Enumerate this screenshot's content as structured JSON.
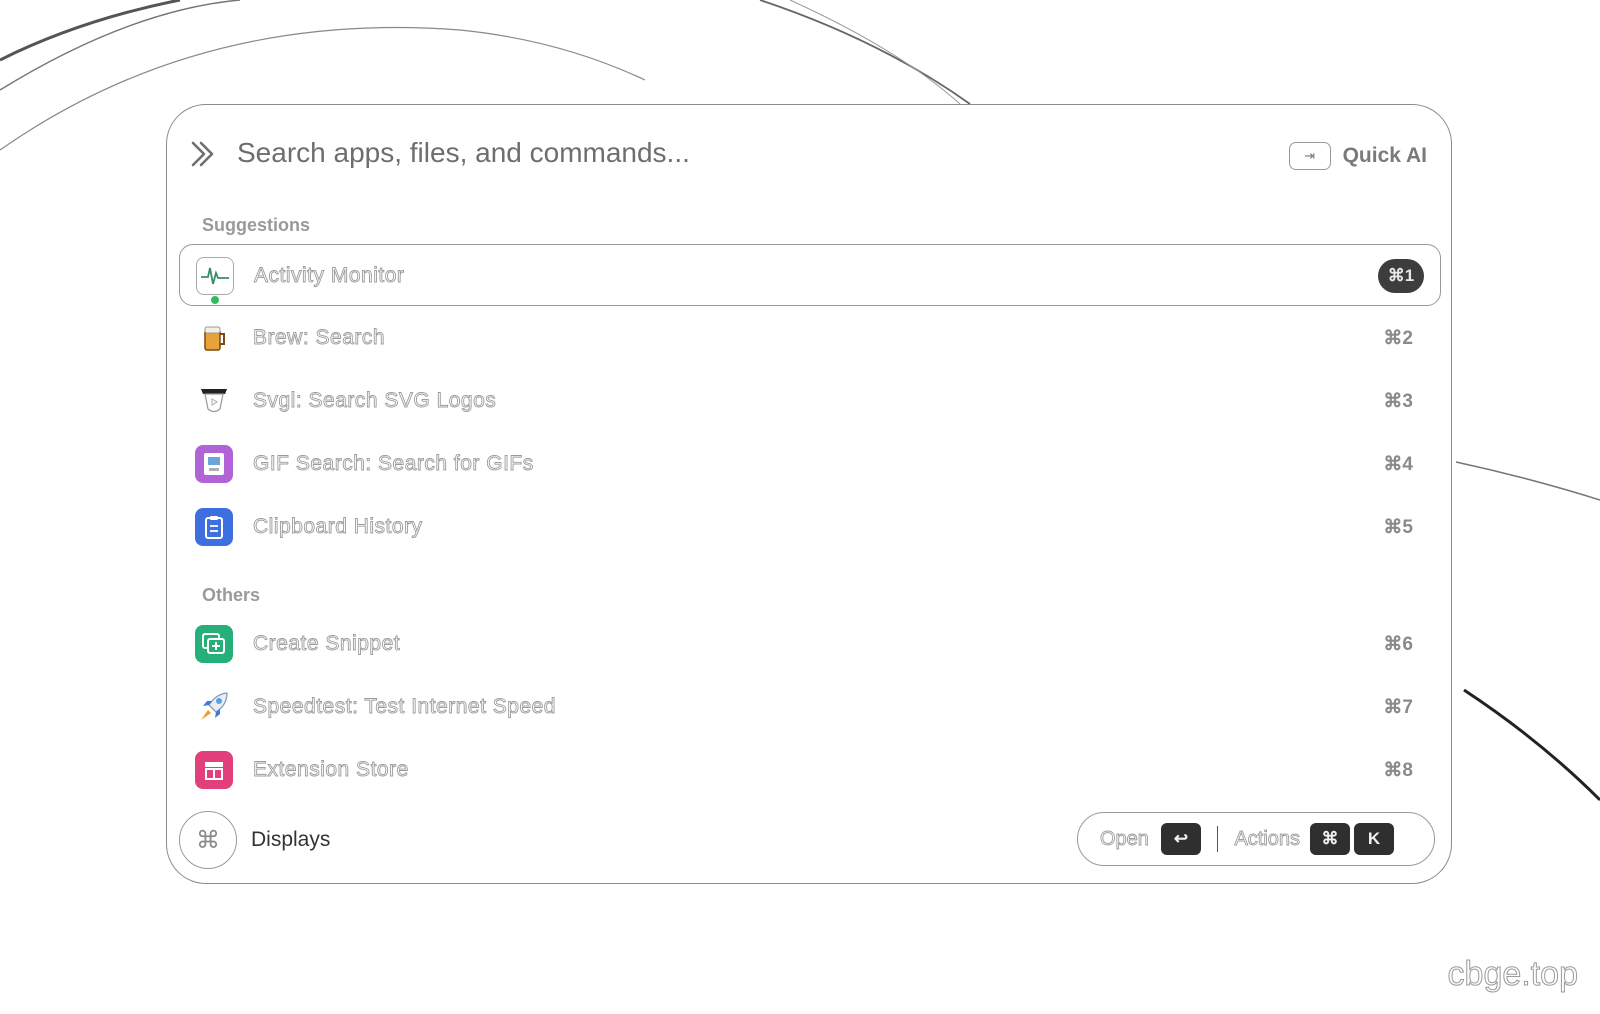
{
  "search": {
    "placeholder": "Search apps, files, and commands...",
    "quick_ai_key": "⇥",
    "quick_ai_label": "Quick AI"
  },
  "sections": {
    "suggestions": "Suggestions",
    "others": "Others"
  },
  "items": [
    {
      "title": "Activity Monitor",
      "shortcut": "⌘1",
      "icon": "activity-monitor-icon",
      "selected": true,
      "running": true
    },
    {
      "title": "Brew: Search",
      "shortcut": "⌘2",
      "icon": "beer-mug-icon"
    },
    {
      "title": "Svgl: Search SVG Logos",
      "shortcut": "⌘3",
      "icon": "svgl-logo-icon"
    },
    {
      "title": "GIF Search: Search for GIFs",
      "shortcut": "⌘4",
      "icon": "gif-search-icon",
      "color": "#b164d6"
    },
    {
      "title": "Clipboard History",
      "shortcut": "⌘5",
      "icon": "clipboard-icon",
      "color": "#3e6fe0"
    },
    {
      "title": "Create Snippet",
      "shortcut": "⌘6",
      "icon": "snippet-icon",
      "color": "#25b07a"
    },
    {
      "title": "Speedtest: Test Internet Speed",
      "shortcut": "⌘7",
      "icon": "rocket-icon"
    },
    {
      "title": "Extension Store",
      "shortcut": "⌘8",
      "icon": "store-icon",
      "color": "#e2407c"
    }
  ],
  "footer": {
    "command_symbol": "⌘",
    "context_label": "Displays",
    "open_label": "Open",
    "open_key": "↩",
    "actions_label": "Actions",
    "actions_key_1": "⌘",
    "actions_key_2": "K"
  },
  "watermark": "cbge.top"
}
